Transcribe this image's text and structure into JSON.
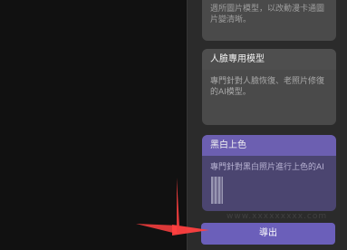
{
  "cards": {
    "top_desc": "週所圖片模型，以改動漫卡通圖片變清晰。",
    "face": {
      "title": "人臉專用模型",
      "desc": "專門針對人臉恢復、老照片修復的AI模型。"
    },
    "colorize": {
      "title": "黑白上色",
      "desc": "專門針對黑白照片進行上色的AI"
    }
  },
  "actions": {
    "export_label": "導出"
  },
  "watermark": "www.xxxxxxxxx.com",
  "colors": {
    "accent": "#6b5fba",
    "arrow": "#ff3b3b"
  }
}
